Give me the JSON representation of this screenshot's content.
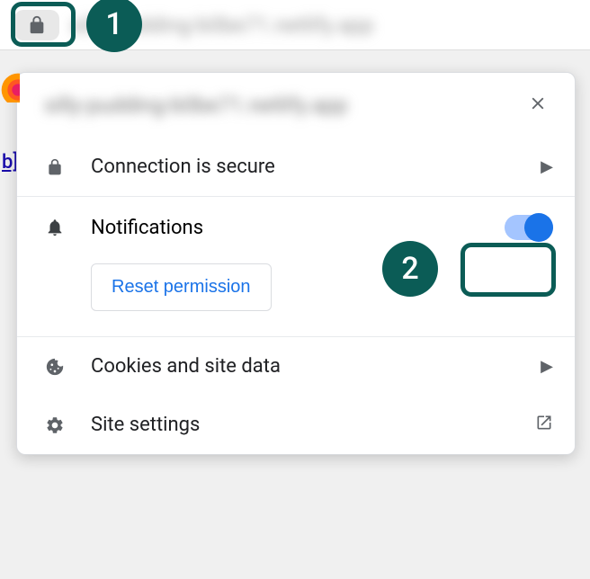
{
  "addressBar": {
    "blurredUrl": "silly-pudding-b0be71.netlify.app"
  },
  "linkFragment": "b]",
  "popup": {
    "title": "silly-pudding-b0be71.netlify.app",
    "connection": {
      "label": "Connection is secure"
    },
    "notifications": {
      "label": "Notifications",
      "toggleOn": true,
      "resetLabel": "Reset permission"
    },
    "cookies": {
      "label": "Cookies and site data"
    },
    "siteSettings": {
      "label": "Site settings"
    }
  },
  "annotations": {
    "badge1": "1",
    "badge2": "2",
    "color": "#0b5c56"
  }
}
